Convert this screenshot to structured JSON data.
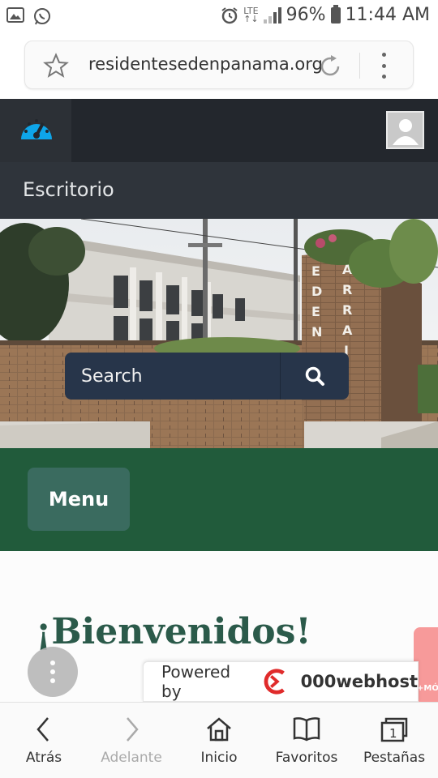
{
  "status_bar": {
    "network": "LTE",
    "battery": "96%",
    "time": "11:44 AM"
  },
  "browser": {
    "url": "residentesedenpanama.org"
  },
  "site": {
    "subnav_title": "Escritorio",
    "search_placeholder": "Search",
    "menu_label": "Menu",
    "welcome": "¡Bienvenidos!"
  },
  "banner": {
    "powered_by": "Powered by",
    "brand": "000webhost",
    "side_ad_text": "+MÓ"
  },
  "bottom_nav": {
    "items": [
      {
        "label": "Atrás",
        "icon": "back-arrow-icon"
      },
      {
        "label": "Adelante",
        "icon": "forward-arrow-icon"
      },
      {
        "label": "Inicio",
        "icon": "home-icon"
      },
      {
        "label": "Favoritos",
        "icon": "bookmarks-icon"
      },
      {
        "label": "Pestañas",
        "icon": "tabs-icon"
      }
    ],
    "tab_count": "1"
  },
  "colors": {
    "header_bg": "#23272d",
    "subnav_bg": "#2f343b",
    "band_green": "#215b3b",
    "menu_button": "#3a6b5f",
    "search_bg": "#27354a",
    "welcome_text": "#2b5a4a",
    "logo_accent": "#0ea5e9"
  }
}
